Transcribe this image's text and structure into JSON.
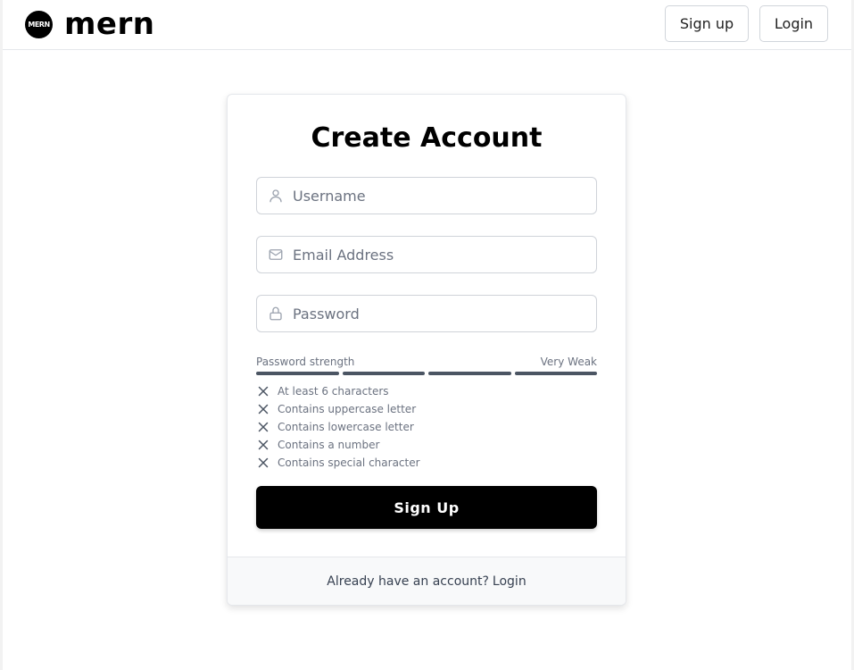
{
  "header": {
    "logo_text": "MERN",
    "brand": "mern",
    "signup_label": "Sign up",
    "login_label": "Login"
  },
  "form": {
    "title": "Create Account",
    "username_placeholder": "Username",
    "email_placeholder": "Email Address",
    "password_placeholder": "Password",
    "strength_label": "Password strength",
    "strength_value": "Very Weak",
    "requirements": [
      "At least 6 characters",
      "Contains uppercase letter",
      "Contains lowercase letter",
      "Contains a number",
      "Contains special character"
    ],
    "submit_label": "Sign Up",
    "footer_text": "Already have an account?",
    "footer_link": "Login"
  },
  "icons": {
    "user": "user-icon",
    "email": "mail-icon",
    "password": "lock-icon",
    "requirement_status": "x-icon"
  }
}
